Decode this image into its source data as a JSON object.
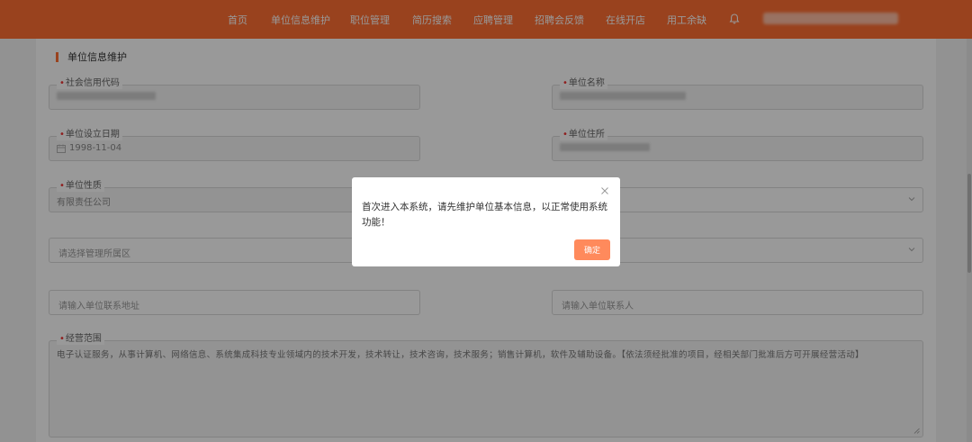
{
  "colors": {
    "brand": "#ff6f33",
    "button": "#ff8a5c",
    "required": "#e33333"
  },
  "nav": {
    "items": [
      "首页",
      "单位信息维护",
      "职位管理",
      "简历搜索",
      "应聘管理",
      "招聘会反馈",
      "在线开店",
      "用工余缺"
    ],
    "bell_icon": "bell-icon"
  },
  "page": {
    "section_title": "单位信息维护",
    "fields": {
      "credit_code_label": "社会信用代码",
      "unit_name_label": "单位名称",
      "establish_date_label": "单位设立日期",
      "establish_date_value": "1998-11-04",
      "address_label": "单位住所",
      "nature_label": "单位性质",
      "nature_value": "有限责任公司",
      "district_placeholder": "请选择管理所属区",
      "contact_address_placeholder": "请输入单位联系地址",
      "contact_person_placeholder": "请输入单位联系人",
      "business_scope_label": "经营范围",
      "business_scope_value": "电子认证服务，从事计算机、网络信息、系统集成科技专业领域内的技术开发，技术转让，技术咨询，技术服务；销售计算机，软件及辅助设备。【依法须经批准的项目，经相关部门批准后方可开展经营活动】"
    }
  },
  "dialog": {
    "message": "首次进入本系统，请先维护单位基本信息，以正常使用系统功能！",
    "confirm_label": "确定"
  }
}
